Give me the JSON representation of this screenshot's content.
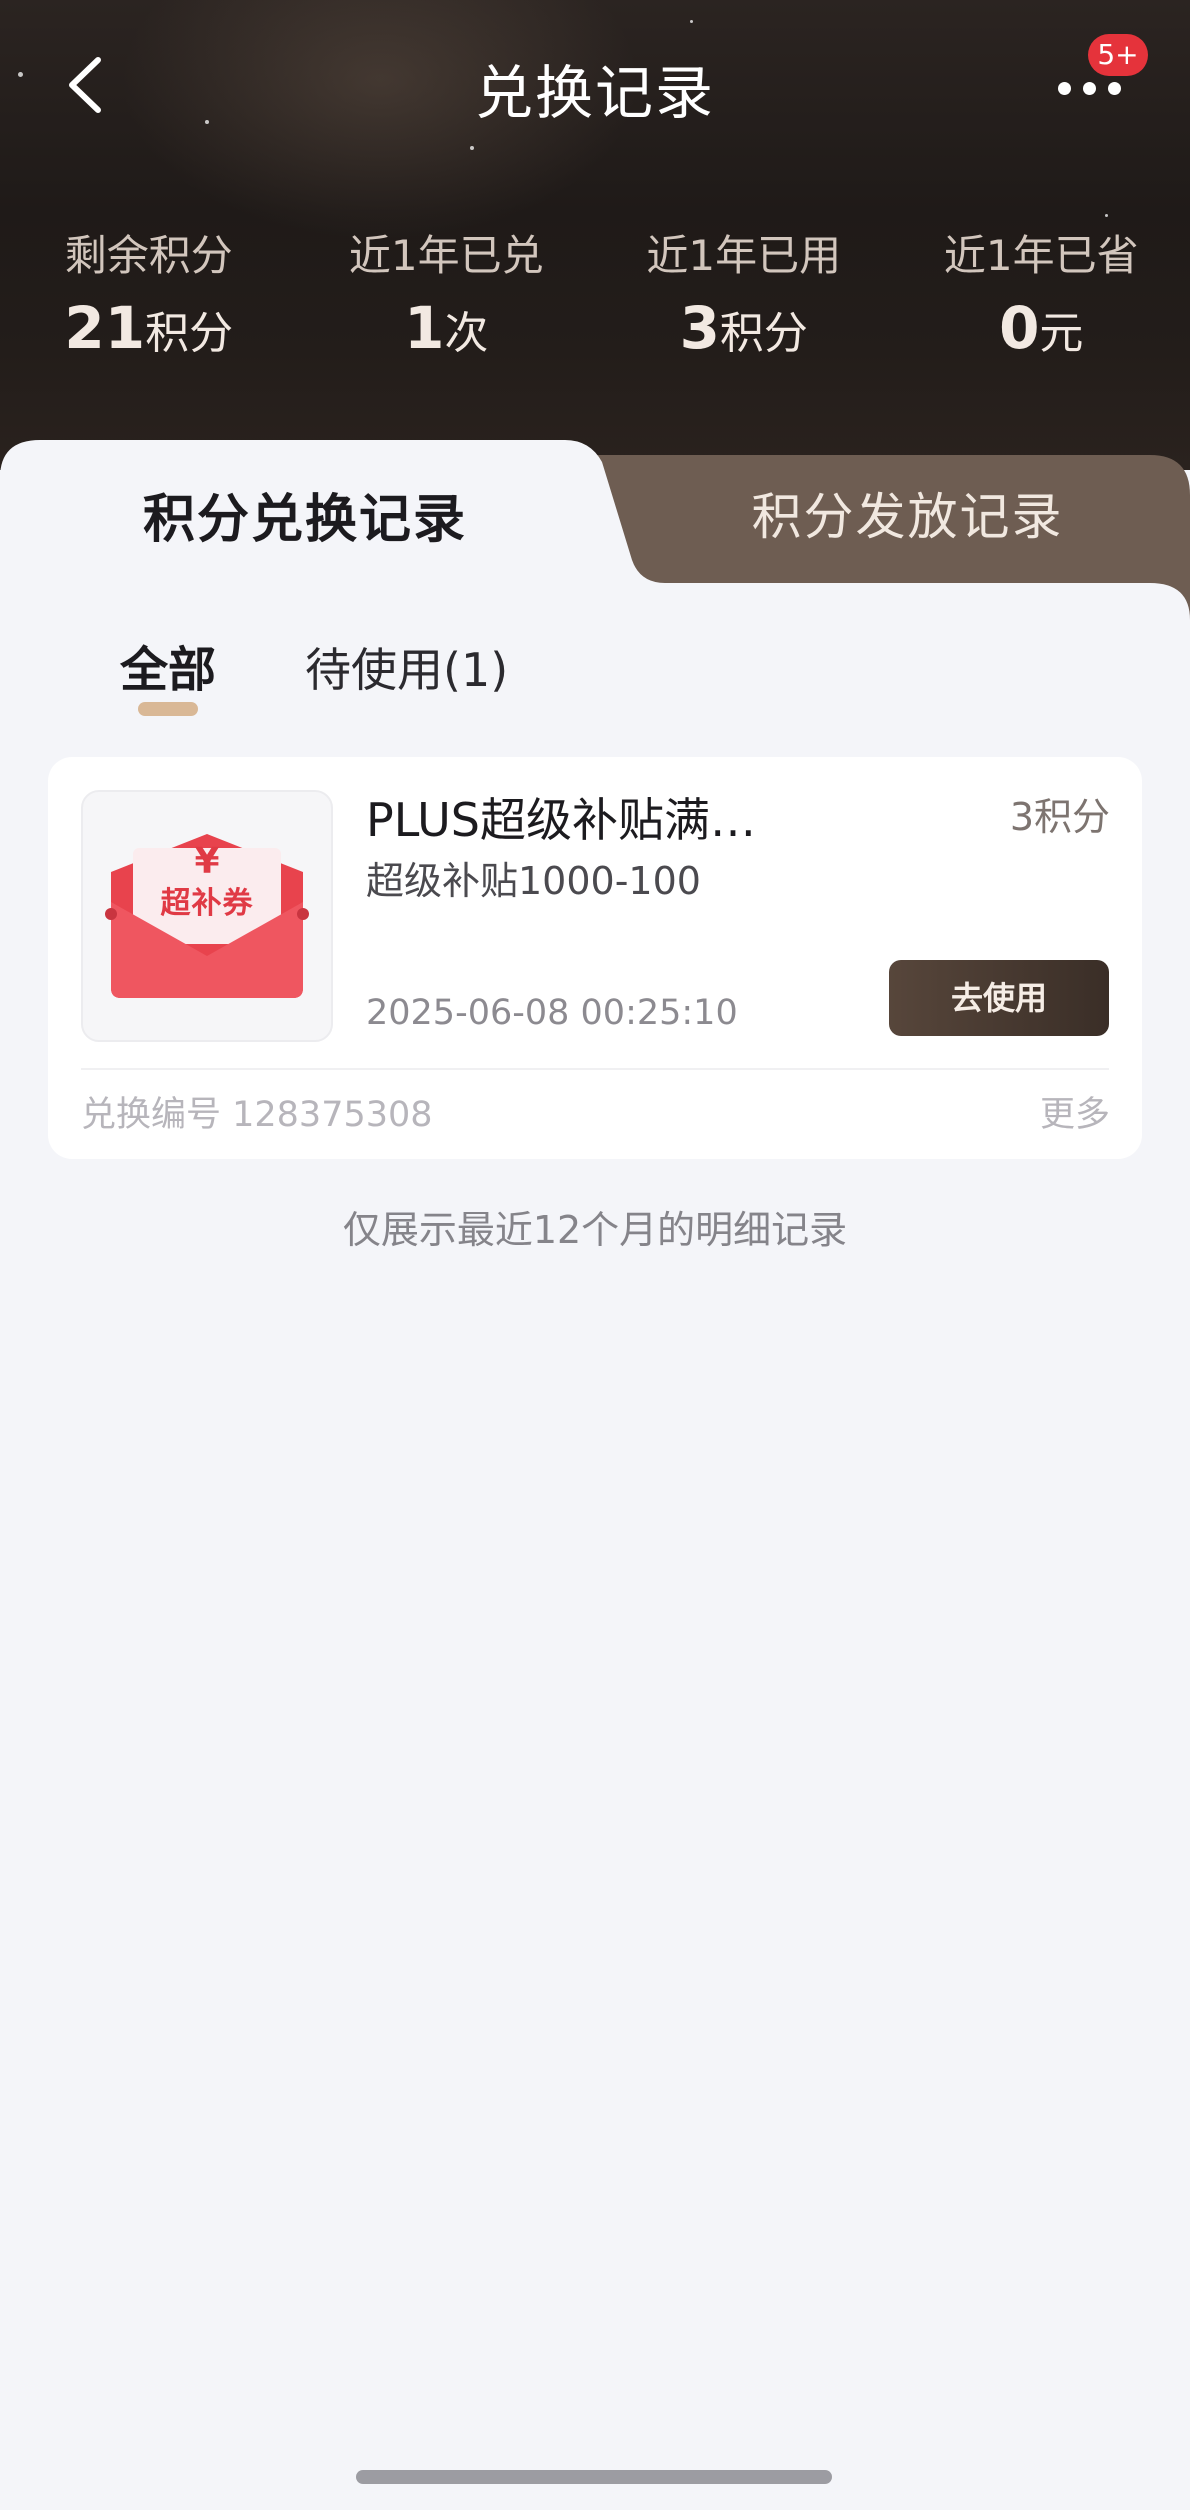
{
  "header": {
    "title": "兑换记录",
    "back_icon": "chevron-left-icon",
    "more_icon": "more-dots-icon",
    "badge": "5+"
  },
  "stats": [
    {
      "label": "剩余积分",
      "value": "21",
      "unit": "积分"
    },
    {
      "label": "近1年已兑",
      "value": "1",
      "unit": "次"
    },
    {
      "label": "近1年已用",
      "value": "3",
      "unit": "积分"
    },
    {
      "label": "近1年已省",
      "value": "0",
      "unit": "元"
    }
  ],
  "tabs": {
    "active": "积分兑换记录",
    "inactive": "积分发放记录"
  },
  "filters": {
    "all": "全部",
    "pending": "待使用(1)"
  },
  "record": {
    "coupon_symbol": "¥",
    "coupon_label": "超补券",
    "title": "PLUS超级补贴满…",
    "points": "3积分",
    "subtitle": "超级补贴1000-100",
    "date": "2025-06-08 00:25:10",
    "use_button": "去使用",
    "order_number": "兑换编号 128375308",
    "more": "更多"
  },
  "footer": {
    "note": "仅展示最近12个月的明细记录"
  },
  "colors": {
    "header_bg": "#1f1a18",
    "accent_brown": "#6e5d52",
    "badge_red": "#e5333b",
    "coupon_red": "#e03a45",
    "page_bg": "#f4f5f9"
  }
}
